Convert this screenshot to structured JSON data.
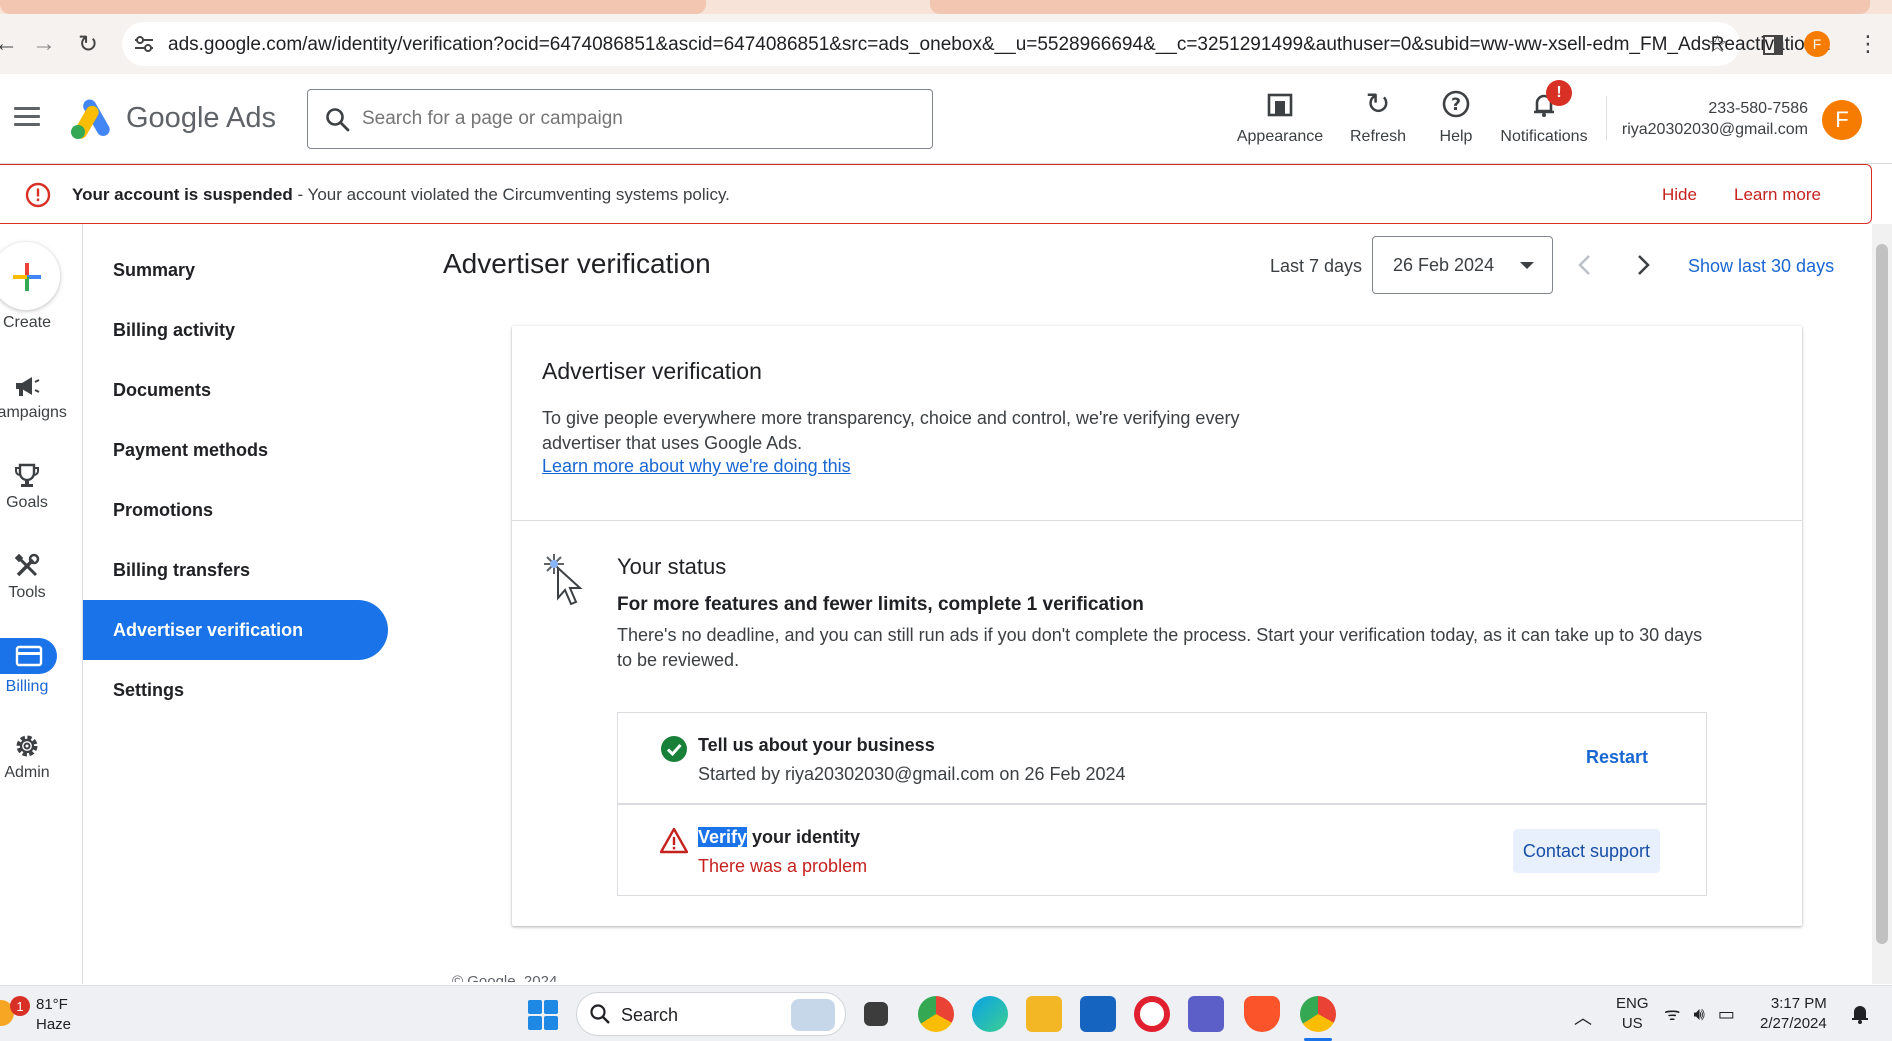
{
  "browser": {
    "url": "ads.google.com/aw/identity/verification?ocid=6474086851&ascid=6474086851&src=ads_onebox&__u=5528966694&__c=3251291499&authuser=0&subid=ww-ww-xsell-edm_FM_AdsReactivation...",
    "profile_initial": "F"
  },
  "header": {
    "brand": "Google Ads",
    "search_placeholder": "Search for a page or campaign",
    "items": [
      {
        "label": "Appearance",
        "icon": "appearance-icon"
      },
      {
        "label": "Refresh",
        "icon": "refresh-icon"
      },
      {
        "label": "Help",
        "icon": "help-icon"
      },
      {
        "label": "Notifications",
        "icon": "bell-icon"
      }
    ],
    "notification_badge": "!",
    "account_id": "233-580-7586",
    "account_email": "riya20302030@gmail.com",
    "avatar_initial": "F"
  },
  "banner": {
    "bold": "Your account is suspended",
    "message": " - Your account violated the Circumventing systems policy.",
    "hide": "Hide",
    "learn_more": "Learn more"
  },
  "rail": [
    {
      "label": "Create",
      "icon": "plus-icon"
    },
    {
      "label": "Campaigns",
      "icon": "megaphone-icon"
    },
    {
      "label": "Goals",
      "icon": "trophy-icon"
    },
    {
      "label": "Tools",
      "icon": "tools-icon"
    },
    {
      "label": "Billing",
      "icon": "billing-icon",
      "active": true
    },
    {
      "label": "Admin",
      "icon": "gear-icon"
    }
  ],
  "nav": [
    "Summary",
    "Billing activity",
    "Documents",
    "Payment methods",
    "Promotions",
    "Billing transfers",
    "Advertiser verification",
    "Settings"
  ],
  "nav_active_index": 6,
  "page": {
    "title": "Advertiser verification",
    "range_label": "Last 7 days",
    "date": "26 Feb 2024",
    "show_last_30": "Show last 30 days"
  },
  "card": {
    "title": "Advertiser verification",
    "description": "To give people everywhere more transparency, choice and control, we're verifying every advertiser that uses Google Ads.",
    "link": "Learn more about why we're doing this",
    "status_title": "Your status",
    "status_subtitle": "For more features and fewer limits, complete 1 verification",
    "status_description": "There's no deadline, and you can still run ads if you don't complete the process. Start your verification today, as it can take up to 30 days to be reviewed.",
    "steps": [
      {
        "title": "Tell us about your business",
        "subtitle": "Started by riya20302030@gmail.com on 26 Feb 2024",
        "action": "Restart",
        "state": "complete"
      },
      {
        "title_highlight": "Verify",
        "title_rest": " your identity",
        "subtitle": "There was a problem",
        "action": "Contact support",
        "state": "problem"
      }
    ]
  },
  "footer": {
    "copyright": "© Google, 2024"
  },
  "taskbar": {
    "weather_badge": "1",
    "temperature": "81°F",
    "condition": "Haze",
    "search_label": "Search",
    "lang_line1": "ENG",
    "lang_line2": "US",
    "time": "3:17 PM",
    "date": "2/27/2024"
  },
  "colors": {
    "primary": "#1a73e8",
    "error": "#d93025",
    "success": "#188038",
    "accent_avatar": "#f57c00"
  }
}
